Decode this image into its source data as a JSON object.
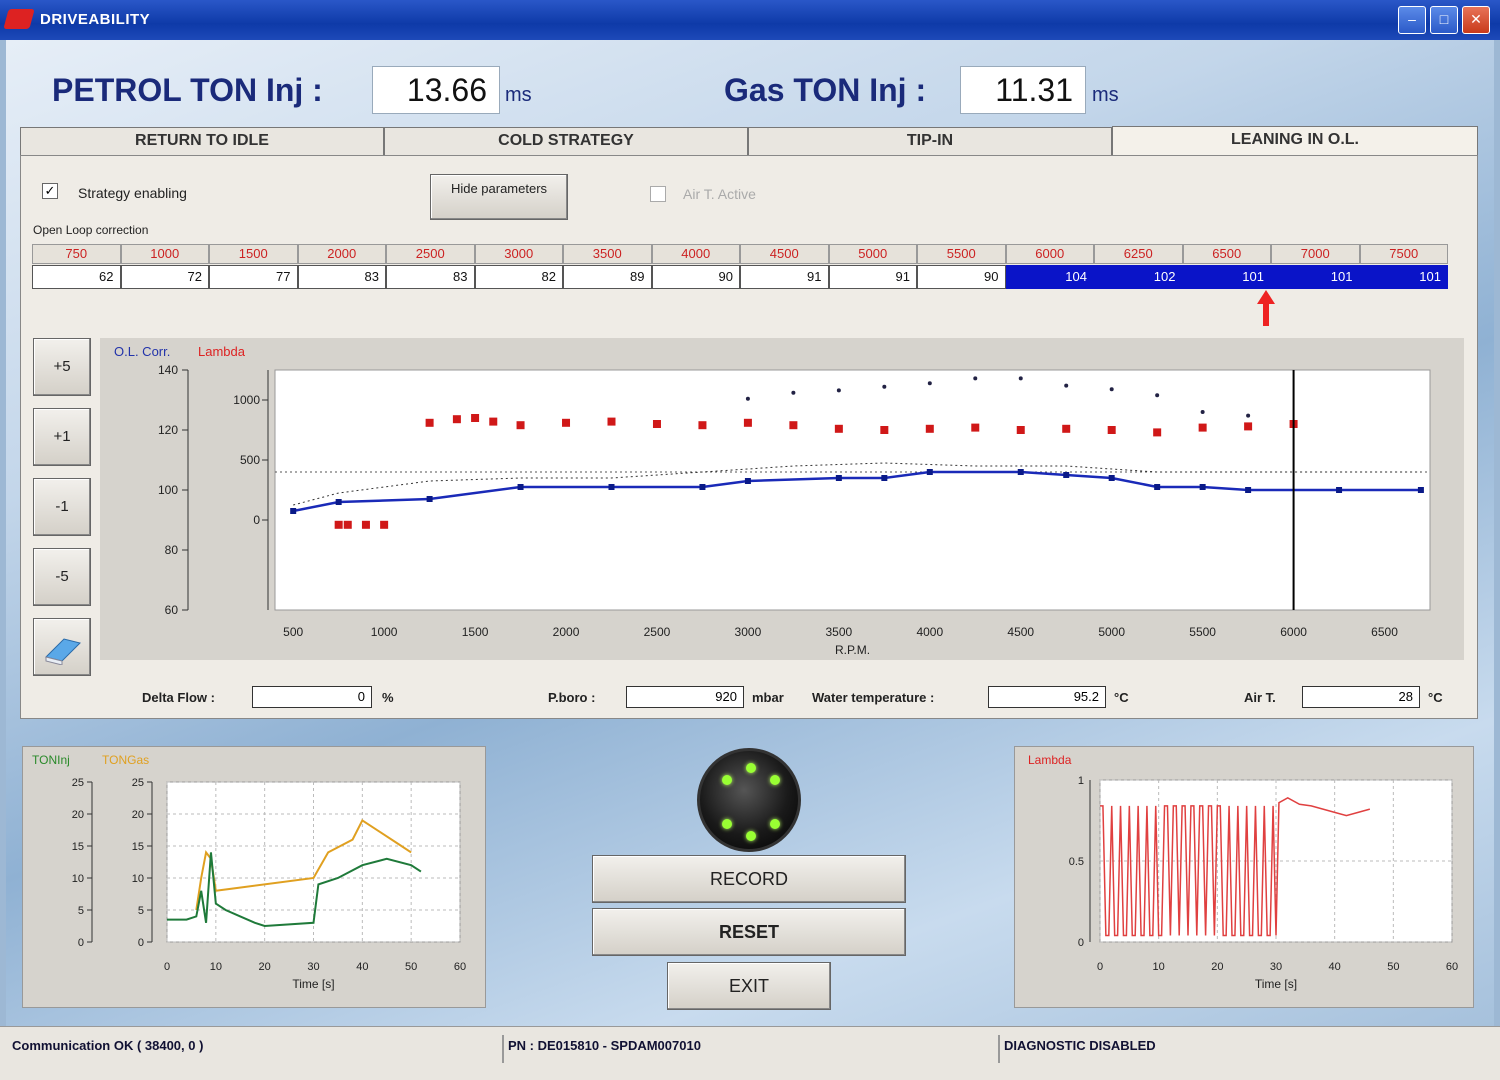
{
  "window": {
    "title": "DRIVEABILITY"
  },
  "header": {
    "petrol_label": "PETROL TON Inj :",
    "petrol_value": "13.66",
    "petrol_unit": "ms",
    "gas_label": "Gas TON Inj :",
    "gas_value": "11.31",
    "gas_unit": "ms"
  },
  "tabs": [
    {
      "label": "RETURN TO IDLE"
    },
    {
      "label": "COLD STRATEGY"
    },
    {
      "label": "TIP-IN"
    },
    {
      "label": "LEANING IN O.L."
    }
  ],
  "panel": {
    "strategy_enabling": "Strategy enabling",
    "hide_parameters": "Hide parameters",
    "air_t_active": "Air T. Active",
    "open_loop_label": "Open Loop correction",
    "rpm_headers": [
      "750",
      "1000",
      "1500",
      "2000",
      "2500",
      "3000",
      "3500",
      "4000",
      "4500",
      "5000",
      "5500",
      "6000",
      "6250",
      "6500",
      "7000",
      "7500"
    ],
    "corrections": [
      "62",
      "72",
      "77",
      "83",
      "83",
      "82",
      "89",
      "90",
      "91",
      "91",
      "90",
      "104",
      "102",
      "101",
      "101",
      "101"
    ],
    "selected_from": 11,
    "step_buttons": [
      "+5",
      "+1",
      "-1",
      "-5"
    ],
    "fields": {
      "delta_flow_label": "Delta Flow :",
      "delta_flow_value": "0",
      "delta_flow_unit": "%",
      "pboro_label": "P.boro :",
      "pboro_value": "920",
      "pboro_unit": "mbar",
      "water_label": "Water temperature :",
      "water_value": "95.2",
      "water_unit": "°C",
      "airt_label": "Air T.",
      "airt_value": "28",
      "airt_unit": "°C"
    }
  },
  "chart_data": [
    {
      "type": "scatter",
      "legend": [
        "O.L. Corr.",
        "Lambda"
      ],
      "xlabel": "R.P.M.",
      "x_ticks": [
        "500",
        "1000",
        "1500",
        "2000",
        "2500",
        "3000",
        "3500",
        "4000",
        "4500",
        "5000",
        "5500",
        "6000",
        "6500"
      ],
      "xlim": [
        400,
        6750
      ],
      "y_left_ticks": [
        "140",
        "120",
        "100",
        "80",
        "60"
      ],
      "y_right_ticks": [
        "1000",
        "500",
        "0"
      ],
      "cursor_x": 6000,
      "series": [
        {
          "name": "O.L. Corr.",
          "points": [
            [
              500,
              93
            ],
            [
              750,
              96
            ],
            [
              1250,
              97
            ],
            [
              1750,
              101
            ],
            [
              2250,
              101
            ],
            [
              2750,
              101
            ],
            [
              3000,
              103
            ],
            [
              3500,
              104
            ],
            [
              3750,
              104
            ],
            [
              4000,
              106
            ],
            [
              4500,
              106
            ],
            [
              4750,
              105
            ],
            [
              5000,
              104
            ],
            [
              5250,
              101
            ],
            [
              5500,
              101
            ],
            [
              5750,
              100
            ],
            [
              6250,
              100
            ],
            [
              6700,
              100
            ]
          ]
        },
        {
          "name": "O.L. Corr. upper",
          "points": [
            [
              500,
              95
            ],
            [
              750,
              99
            ],
            [
              1250,
              103
            ],
            [
              1750,
              104
            ],
            [
              2250,
              104
            ],
            [
              2750,
              106
            ],
            [
              3250,
              108
            ],
            [
              3750,
              109
            ],
            [
              4250,
              108
            ],
            [
              4750,
              108
            ],
            [
              5250,
              106
            ],
            [
              5750,
              106
            ],
            [
              6250,
              106
            ],
            [
              6700,
              106
            ]
          ]
        },
        {
          "name": "Lambda",
          "points": [
            [
              750,
              -40
            ],
            [
              800,
              -40
            ],
            [
              900,
              -40
            ],
            [
              1000,
              -40
            ],
            [
              1250,
              810
            ],
            [
              1400,
              840
            ],
            [
              1500,
              850
            ],
            [
              1600,
              820
            ],
            [
              1750,
              790
            ],
            [
              2000,
              810
            ],
            [
              2250,
              820
            ],
            [
              2500,
              800
            ],
            [
              2750,
              790
            ],
            [
              3000,
              810
            ],
            [
              3250,
              790
            ],
            [
              3500,
              760
            ],
            [
              3750,
              750
            ],
            [
              4000,
              760
            ],
            [
              4250,
              770
            ],
            [
              4500,
              750
            ],
            [
              4750,
              760
            ],
            [
              5000,
              750
            ],
            [
              5250,
              730
            ],
            [
              5500,
              770
            ],
            [
              5750,
              780
            ],
            [
              6000,
              800
            ]
          ]
        },
        {
          "name": "Lambda dots",
          "points": [
            [
              3000,
              1010
            ],
            [
              3250,
              1060
            ],
            [
              3500,
              1080
            ],
            [
              3750,
              1110
            ],
            [
              4000,
              1140
            ],
            [
              4250,
              1180
            ],
            [
              4500,
              1180
            ],
            [
              4750,
              1120
            ],
            [
              5000,
              1090
            ],
            [
              5250,
              1040
            ],
            [
              5500,
              900
            ],
            [
              5750,
              870
            ]
          ]
        }
      ]
    },
    {
      "type": "line",
      "legend": [
        "TONInj",
        "TONGas"
      ],
      "xlabel": "Time [s]",
      "x_ticks": [
        "0",
        "10",
        "20",
        "30",
        "40",
        "50",
        "60"
      ],
      "xlim": [
        0,
        60
      ],
      "y_ticks": [
        "25",
        "20",
        "15",
        "10",
        "5",
        "0"
      ],
      "ylim": [
        0,
        25
      ],
      "series": [
        {
          "name": "TONInj",
          "points": [
            [
              0,
              3.5
            ],
            [
              4,
              3.5
            ],
            [
              6,
              4
            ],
            [
              7,
              8
            ],
            [
              8,
              3
            ],
            [
              9,
              14
            ],
            [
              10,
              6
            ],
            [
              12,
              5
            ],
            [
              15,
              4
            ],
            [
              18,
              3
            ],
            [
              20,
              2.5
            ],
            [
              30,
              3
            ],
            [
              31,
              9
            ],
            [
              35,
              10
            ],
            [
              40,
              12
            ],
            [
              45,
              13
            ],
            [
              50,
              12
            ],
            [
              52,
              11
            ]
          ]
        },
        {
          "name": "TONGas",
          "points": [
            [
              6,
              5
            ],
            [
              7,
              10
            ],
            [
              8,
              14
            ],
            [
              9,
              13
            ],
            [
              10,
              8
            ],
            [
              30,
              10
            ],
            [
              33,
              14
            ],
            [
              38,
              16
            ],
            [
              40,
              19
            ],
            [
              44,
              17
            ],
            [
              48,
              15
            ],
            [
              50,
              14
            ]
          ]
        }
      ]
    },
    {
      "type": "line",
      "legend": [
        "Lambda"
      ],
      "xlabel": "Time [s]",
      "x_ticks": [
        "0",
        "10",
        "20",
        "30",
        "40",
        "50",
        "60"
      ],
      "xlim": [
        0,
        60
      ],
      "y_ticks": [
        "1",
        "0.5",
        "0"
      ],
      "ylim": [
        0,
        1
      ]
    }
  ],
  "controls": {
    "record": "RECORD",
    "reset": "RESET",
    "exit": "EXIT"
  },
  "statusbar": {
    "comm": "Communication OK ( 38400, 0 )",
    "pn": "PN : DE015810 - SPDAM007010",
    "diag": "DIAGNOSTIC DISABLED"
  }
}
